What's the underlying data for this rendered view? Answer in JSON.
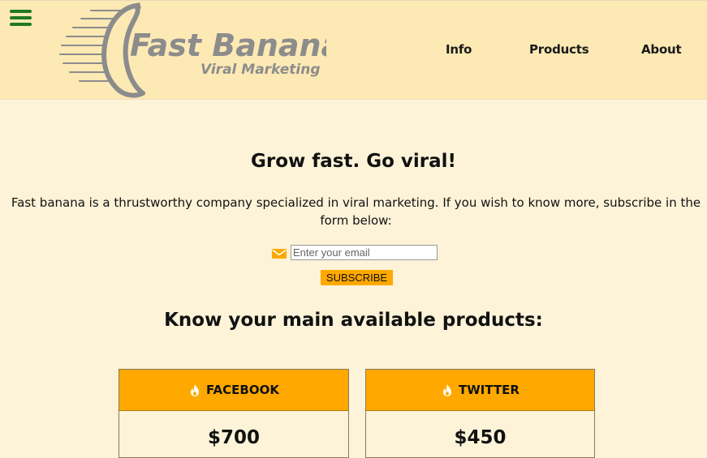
{
  "brand": {
    "name": "Fast Banana",
    "tagline": "Viral Marketing",
    "logo_color": "#8c8c8c"
  },
  "menu_icon": "hamburger-menu-icon",
  "nav": {
    "info": "Info",
    "products": "Products",
    "about": "About"
  },
  "hero": {
    "title": "Grow fast. Go viral!",
    "intro": "Fast banana is a thrustworthy company specialized in viral marketing. If you wish to know more, subscribe in the form below:"
  },
  "subscribe": {
    "icon": "mail-icon",
    "placeholder": "Enter your email",
    "value": "",
    "button_label": "SUBSCRIBE"
  },
  "products": {
    "title": "Know your main available products:",
    "items": [
      {
        "name": "FACEBOOK",
        "price": "$700",
        "icon": "fire-icon"
      },
      {
        "name": "TWITTER",
        "price": "$450",
        "icon": "fire-icon"
      }
    ]
  },
  "colors": {
    "page_bg": "#fdf3d8",
    "header_bg": "#fde9b4",
    "accent": "#ffa800",
    "menu_icon": "#1f7a1f"
  }
}
